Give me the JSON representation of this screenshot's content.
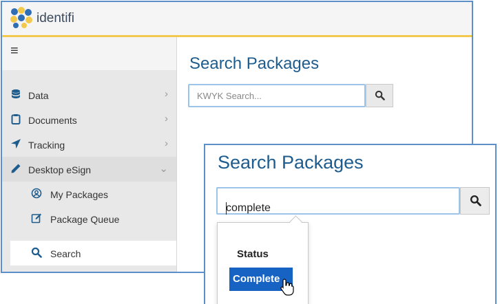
{
  "app": {
    "brand": "identifi"
  },
  "sidebar": {
    "menu_icon": "hamburger-icon",
    "items": [
      {
        "label": "Data",
        "icon": "database-icon",
        "chevron": "›"
      },
      {
        "label": "Documents",
        "icon": "clipboard-icon",
        "chevron": "›"
      },
      {
        "label": "Tracking",
        "icon": "location-arrow-icon",
        "chevron": "›"
      },
      {
        "label": "Desktop eSign",
        "icon": "pencil-icon",
        "chevron": "⌄"
      }
    ],
    "sub_items": [
      {
        "label": "My Packages",
        "icon": "user-circle-icon"
      },
      {
        "label": "Package Queue",
        "icon": "edit-icon"
      },
      {
        "label": "Search",
        "icon": "search-icon"
      }
    ]
  },
  "back_view": {
    "title": "Search Packages",
    "search_placeholder": "KWYK Search..."
  },
  "front_view": {
    "title": "Search Packages",
    "search_value": "complete",
    "dropdown_header": "Status",
    "dropdown_option": "Complete"
  },
  "colors": {
    "accent_blue": "#1e5c8e",
    "highlight": "#1763c4",
    "topbar_border": "#f2c94c",
    "window_border": "#5b8fcb"
  }
}
